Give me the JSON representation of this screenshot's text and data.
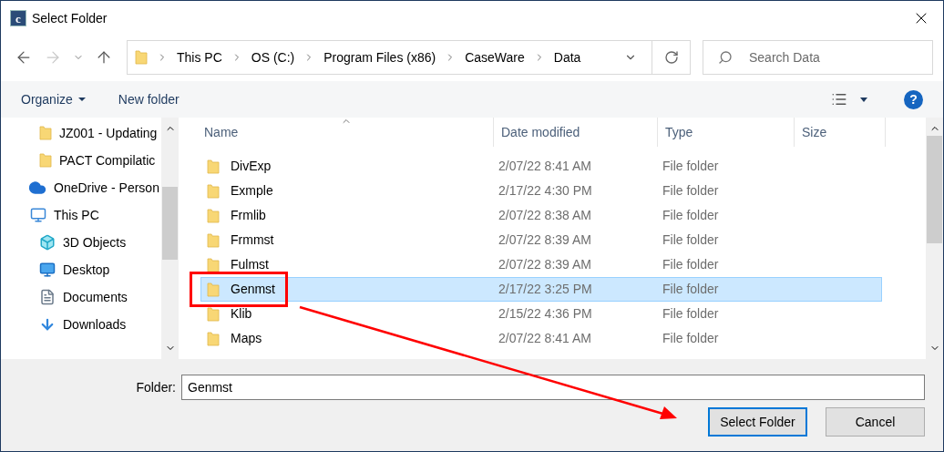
{
  "window": {
    "title": "Select Folder",
    "app_icon_letter": "c"
  },
  "nav_buttons": [
    {
      "kind": "back",
      "disabled": false
    },
    {
      "kind": "forward",
      "disabled": true
    },
    {
      "kind": "recent",
      "disabled": false
    },
    {
      "kind": "up",
      "disabled": false
    }
  ],
  "address": {
    "path": [
      "This PC",
      "OS (C:)",
      "Program Files (x86)",
      "CaseWare",
      "Data"
    ]
  },
  "search": {
    "placeholder": "Search Data"
  },
  "toolbar": {
    "organize": "Organize",
    "new_folder": "New folder",
    "help": "?"
  },
  "sidebar": {
    "items": [
      {
        "kind": "folder",
        "label": "JZ001 - Updating"
      },
      {
        "kind": "folder",
        "label": "PACT Compilatic"
      },
      {
        "kind": "onedrive",
        "label": "OneDrive - Person"
      },
      {
        "kind": "pc",
        "label": "This PC",
        "children": [
          {
            "kind": "objects3d",
            "label": "3D Objects"
          },
          {
            "kind": "desktop",
            "label": "Desktop"
          },
          {
            "kind": "documents",
            "label": "Documents"
          },
          {
            "kind": "downloads",
            "label": "Downloads"
          }
        ]
      }
    ]
  },
  "table": {
    "columns": [
      "Name",
      "Date modified",
      "Type",
      "Size"
    ],
    "rows": [
      {
        "name": "DivExp",
        "date": "2/07/22 8:41 AM",
        "type": "File folder",
        "selected": false
      },
      {
        "name": "Exmple",
        "date": "2/17/22 4:30 PM",
        "type": "File folder",
        "selected": false
      },
      {
        "name": "Frmlib",
        "date": "2/07/22 8:38 AM",
        "type": "File folder",
        "selected": false
      },
      {
        "name": "Frmmst",
        "date": "2/07/22 8:39 AM",
        "type": "File folder",
        "selected": false
      },
      {
        "name": "Fulmst",
        "date": "2/07/22 8:39 AM",
        "type": "File folder",
        "selected": false
      },
      {
        "name": "Genmst",
        "date": "2/17/22 3:25 PM",
        "type": "File folder",
        "selected": true
      },
      {
        "name": "Klib",
        "date": "2/15/22 4:36 PM",
        "type": "File folder",
        "selected": false
      },
      {
        "name": "Maps",
        "date": "2/07/22 8:41 AM",
        "type": "File folder",
        "selected": false
      }
    ]
  },
  "folder_field": {
    "label": "Folder:",
    "value": "Genmst"
  },
  "buttons": [
    {
      "label": "Select Folder",
      "default": true
    },
    {
      "label": "Cancel",
      "default": false
    }
  ]
}
